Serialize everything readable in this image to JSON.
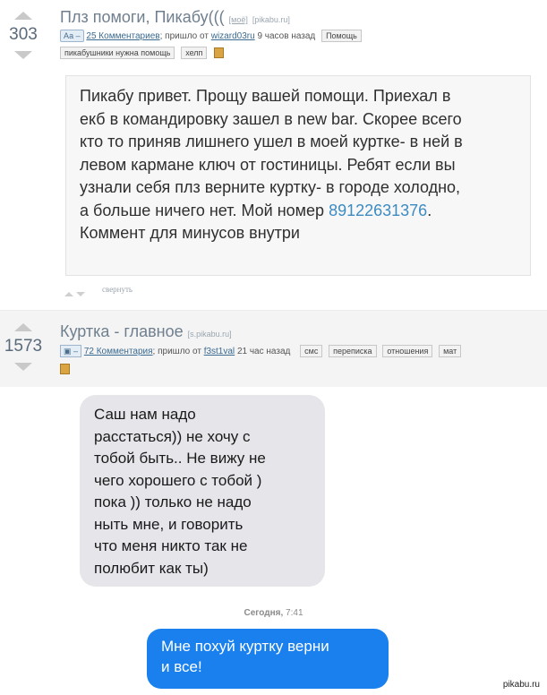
{
  "post1": {
    "rating": "303",
    "title": "Плз помоги, Пикабу(((",
    "source": "[моё]",
    "source_domain": "[pikabu.ru]",
    "type_pill": "Аа –",
    "comments_link": "25 Комментариев",
    "posted_by_prefix": "; пришло от",
    "author": "wizard03ru",
    "time_ago": "9 часов назад",
    "tags": [
      "Помощь",
      "пикабушники нужна помощь",
      "хелп"
    ],
    "text_lines": [
      "Пикабу привет. Прощу вашей помощи. Приехал в",
      "екб в командировку зашел в new bar. Скорее всего",
      "кто то приняв лишнего ушел в моей куртке- в ней в",
      "левом кармане ключ от гостиницы. Ребят если вы",
      "узнали себя плз верните куртку- в городе холодно,",
      "а больше ничего нет. Мой номер "
    ],
    "phone": "89122631376",
    "text_after_phone": ".",
    "text_last_line": "Коммент для минусов внутри",
    "collapse_label": "свернуть"
  },
  "post2": {
    "rating": "1573",
    "title": "Куртка - главное",
    "source_domain": "[s.pikabu.ru]",
    "type_pill": "–",
    "comments_link": "72 Комментария",
    "posted_by_prefix": "; пришло от",
    "author": "f3st1val",
    "time_ago": "21 час назад",
    "tags": [
      "смс",
      "переписка",
      "отношения",
      "мат"
    ]
  },
  "chat": {
    "incoming_lines": [
      "Саш нам надо",
      "расстаться)) не хочу с",
      "тобой быть.. Не вижу не",
      "чего хорошего с тобой )",
      "пока )) только не надо",
      "ныть мне, и говорить",
      "что меня никто так не",
      "полюбит как ты)"
    ],
    "timestamp_day": "Сегодня,",
    "timestamp_time": "7:41",
    "outgoing_lines": [
      "Мне похуй куртку верни",
      "и все!"
    ],
    "watermark": "pikabu.ru"
  },
  "colors": {
    "accent_link": "#3a6a90",
    "phone": "#3d8bc0",
    "imessage_blue": "#1a80ee",
    "sms_gray": "#e5e5ea"
  }
}
